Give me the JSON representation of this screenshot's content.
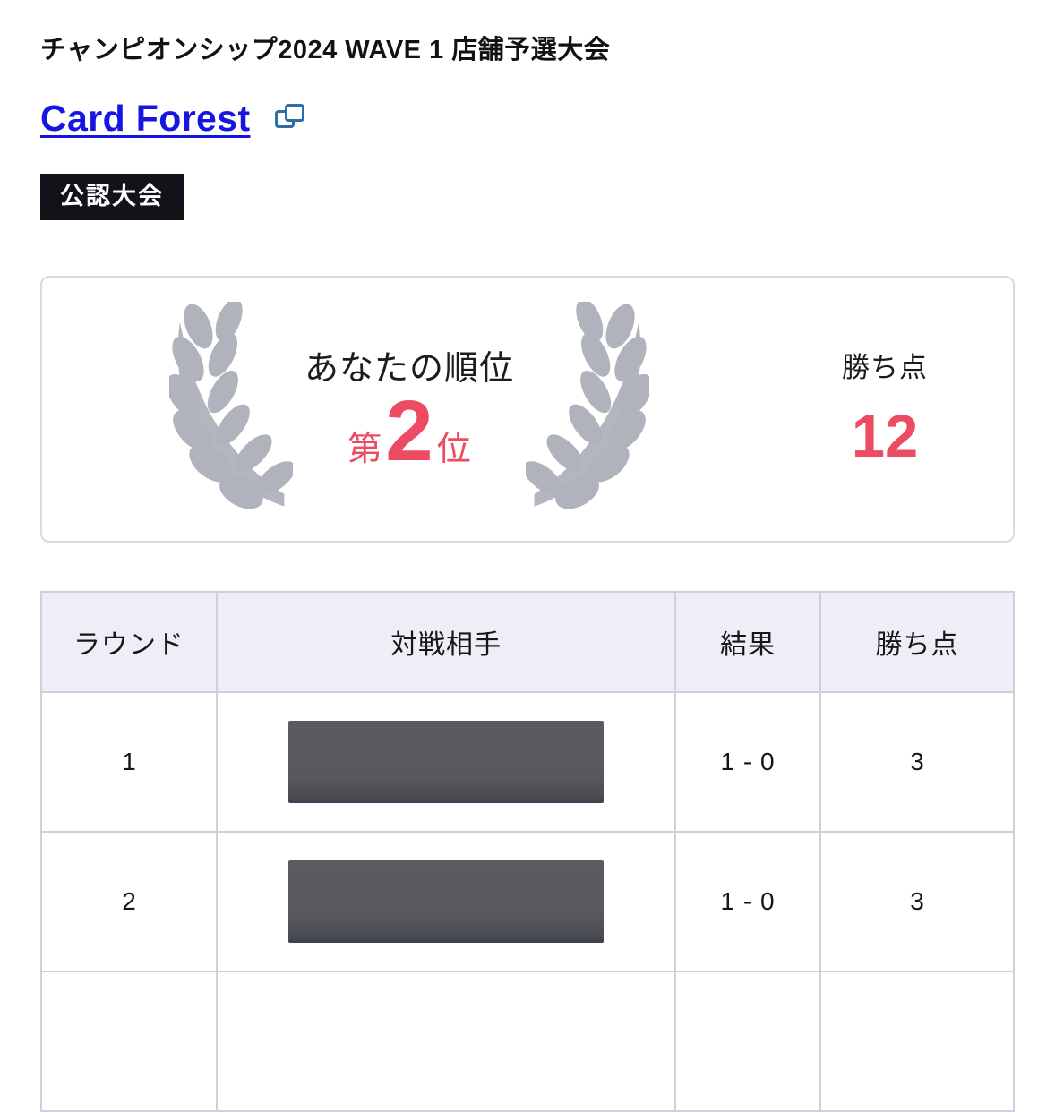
{
  "event": {
    "title": "チャンピオンシップ2024 WAVE 1 店舗予選大会"
  },
  "shop": {
    "name": "Card Forest",
    "copy_icon": "copy-icon"
  },
  "badge": {
    "label": "公認大会"
  },
  "rank_card": {
    "rank_label": "あなたの順位",
    "rank_prefix": "第",
    "rank_number": "2",
    "rank_suffix": "位",
    "points_label": "勝ち点",
    "points_value": "12",
    "wreath_icon": "laurel-wreath-icon",
    "accent_color": "#ec4b62",
    "wreath_color": "#b0b2bc"
  },
  "results": {
    "columns": [
      "ラウンド",
      "対戦相手",
      "結果",
      "勝ち点"
    ],
    "rows": [
      {
        "round": "1",
        "opponent": "",
        "opponent_redacted": true,
        "result": "1 - 0",
        "points": "3"
      },
      {
        "round": "2",
        "opponent": "",
        "opponent_redacted": true,
        "result": "1 - 0",
        "points": "3"
      },
      {
        "round": "",
        "opponent": "",
        "opponent_redacted": false,
        "result": "",
        "points": ""
      }
    ]
  }
}
